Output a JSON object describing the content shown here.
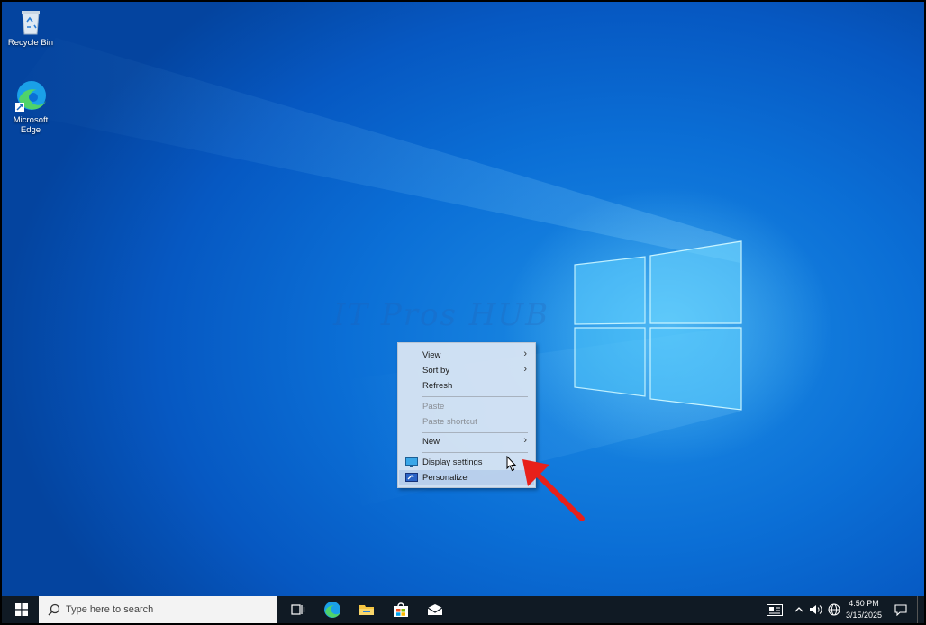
{
  "desktop": {
    "icons": [
      {
        "label": "Recycle Bin",
        "icon": "recycle-bin-icon"
      },
      {
        "label": "Microsoft Edge",
        "icon": "edge-icon"
      }
    ],
    "watermark": "IT Pros HUB"
  },
  "context_menu": {
    "items": [
      {
        "label": "View",
        "has_submenu": true,
        "disabled": false
      },
      {
        "label": "Sort by",
        "has_submenu": true,
        "disabled": false
      },
      {
        "label": "Refresh",
        "has_submenu": false,
        "disabled": false
      },
      {
        "label": "Paste",
        "has_submenu": false,
        "disabled": true
      },
      {
        "label": "Paste shortcut",
        "has_submenu": false,
        "disabled": true
      },
      {
        "label": "New",
        "has_submenu": true,
        "disabled": false
      },
      {
        "label": "Display settings",
        "icon": "display-icon",
        "disabled": false
      },
      {
        "label": "Personalize",
        "icon": "personalize-icon",
        "disabled": false
      }
    ],
    "highlighted": "Personalize"
  },
  "annotation": {
    "arrow_color": "#e8201a"
  },
  "taskbar": {
    "search_placeholder": "Type here to search",
    "pinned": [
      "task-view-icon",
      "edge-icon",
      "file-explorer-icon",
      "store-icon",
      "mail-icon"
    ],
    "tray": [
      "news-icon",
      "chevron-up-icon",
      "volume-icon",
      "network-icon"
    ],
    "clock_time": "4:50 PM",
    "clock_date": "3/15/2025"
  },
  "colors": {
    "desktop": "#0b6fd6",
    "taskbar": "#101a24",
    "menu": "#dee8f4"
  }
}
